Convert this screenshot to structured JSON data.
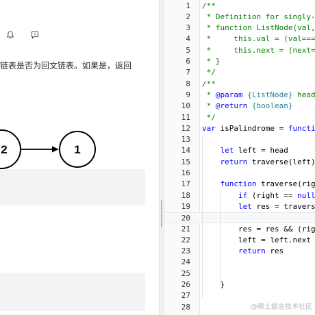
{
  "problem": {
    "description": "链表是否为回文链表。如果是，返回",
    "diagram_nodes": [
      "2",
      "1"
    ]
  },
  "editor": {
    "lines": [
      {
        "n": "1",
        "tokens": [
          {
            "t": "/**",
            "c": "comment"
          }
        ]
      },
      {
        "n": "2",
        "tokens": [
          {
            "t": " * Definition for singly-l",
            "c": "comment"
          }
        ]
      },
      {
        "n": "3",
        "tokens": [
          {
            "t": " * function ListNode(val, ",
            "c": "comment"
          }
        ]
      },
      {
        "n": "4",
        "tokens": [
          {
            "t": " *     this.val = (val===u",
            "c": "comment"
          }
        ]
      },
      {
        "n": "5",
        "tokens": [
          {
            "t": " *     this.next = (next==",
            "c": "comment"
          }
        ]
      },
      {
        "n": "6",
        "tokens": [
          {
            "t": " * }",
            "c": "comment"
          }
        ]
      },
      {
        "n": "7",
        "tokens": [
          {
            "t": " */",
            "c": "comment"
          }
        ]
      },
      {
        "n": "8",
        "tokens": [
          {
            "t": "/**",
            "c": "comment"
          }
        ]
      },
      {
        "n": "9",
        "tokens": [
          {
            "t": " * ",
            "c": "comment"
          },
          {
            "t": "@param",
            "c": "doctag"
          },
          {
            "t": " ",
            "c": "comment"
          },
          {
            "t": "{ListNode}",
            "c": "doctype"
          },
          {
            "t": " head",
            "c": "comment"
          }
        ]
      },
      {
        "n": "10",
        "tokens": [
          {
            "t": " * ",
            "c": "comment"
          },
          {
            "t": "@return",
            "c": "doctag"
          },
          {
            "t": " ",
            "c": "comment"
          },
          {
            "t": "{boolean}",
            "c": "doctype"
          }
        ]
      },
      {
        "n": "11",
        "tokens": [
          {
            "t": " */",
            "c": "comment"
          }
        ]
      },
      {
        "n": "12",
        "tokens": [
          {
            "t": "var",
            "c": "keyword"
          },
          {
            "t": " isPalindrome = ",
            "c": "plain"
          },
          {
            "t": "functio",
            "c": "keyword"
          }
        ]
      },
      {
        "n": "13",
        "tokens": []
      },
      {
        "n": "14",
        "tokens": [
          {
            "t": "    ",
            "c": "plain"
          },
          {
            "t": "let",
            "c": "keyword"
          },
          {
            "t": " left = head",
            "c": "plain"
          }
        ]
      },
      {
        "n": "15",
        "tokens": [
          {
            "t": "    ",
            "c": "plain"
          },
          {
            "t": "return",
            "c": "keyword"
          },
          {
            "t": " traverse(left)",
            "c": "plain"
          }
        ]
      },
      {
        "n": "16",
        "tokens": []
      },
      {
        "n": "17",
        "tokens": [
          {
            "t": "    ",
            "c": "plain"
          },
          {
            "t": "function",
            "c": "keyword"
          },
          {
            "t": " traverse(righ",
            "c": "plain"
          }
        ]
      },
      {
        "n": "18",
        "tokens": [
          {
            "t": "        ",
            "c": "plain"
          },
          {
            "t": "if",
            "c": "keyword"
          },
          {
            "t": " (right == ",
            "c": "plain"
          },
          {
            "t": "null",
            "c": "keyword"
          },
          {
            "t": ")",
            "c": "plain"
          }
        ]
      },
      {
        "n": "19",
        "tokens": [
          {
            "t": "        ",
            "c": "plain"
          },
          {
            "t": "let",
            "c": "keyword"
          },
          {
            "t": " res = traverse",
            "c": "plain"
          }
        ]
      },
      {
        "n": "20",
        "tokens": [],
        "active": true
      },
      {
        "n": "21",
        "tokens": [
          {
            "t": "        res = res && (righ",
            "c": "plain"
          }
        ]
      },
      {
        "n": "22",
        "tokens": [
          {
            "t": "        left = left.next",
            "c": "plain"
          }
        ]
      },
      {
        "n": "23",
        "tokens": [
          {
            "t": "        ",
            "c": "plain"
          },
          {
            "t": "return",
            "c": "keyword"
          },
          {
            "t": " res",
            "c": "plain"
          }
        ]
      },
      {
        "n": "24",
        "tokens": []
      },
      {
        "n": "25",
        "tokens": []
      },
      {
        "n": "26",
        "tokens": [
          {
            "t": "    }",
            "c": "plain"
          }
        ]
      },
      {
        "n": "27",
        "tokens": []
      },
      {
        "n": "28",
        "tokens": []
      }
    ]
  },
  "watermark": "@稀土掘金技术社区",
  "icons": {
    "toolbar": [
      "bell-icon",
      "comment-icon"
    ]
  }
}
